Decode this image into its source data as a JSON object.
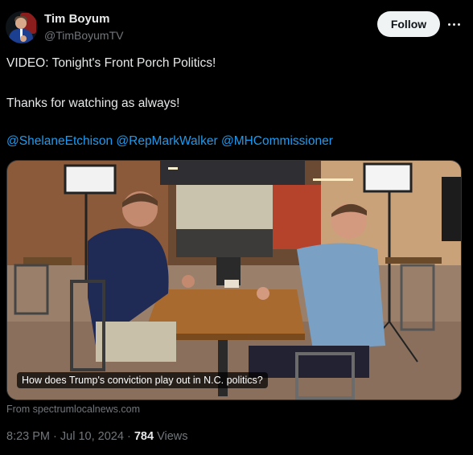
{
  "author": {
    "display_name": "Tim Boyum",
    "handle": "@TimBoyumTV"
  },
  "actions": {
    "follow_label": "Follow",
    "more_icon": "more-horizontal-icon"
  },
  "tweet": {
    "line1": "VIDEO: Tonight's Front Porch Politics!",
    "line2": "Thanks for watching as always!",
    "mentions": [
      "@ShelaneEtchison",
      "@RepMarkWalker",
      "@MHCommissioner"
    ]
  },
  "media": {
    "caption": "How does Trump's conviction play out in N.C. politics?",
    "source": "From spectrumlocalnews.com"
  },
  "meta": {
    "time": "8:23 PM",
    "date": "Jul 10, 2024",
    "separator": "·",
    "views_count": "784",
    "views_label": "Views"
  },
  "colors": {
    "background": "#000000",
    "text": "#e7e9ea",
    "muted": "#71767b",
    "link": "#1d9bf0",
    "follow_bg": "#eff3f4"
  }
}
